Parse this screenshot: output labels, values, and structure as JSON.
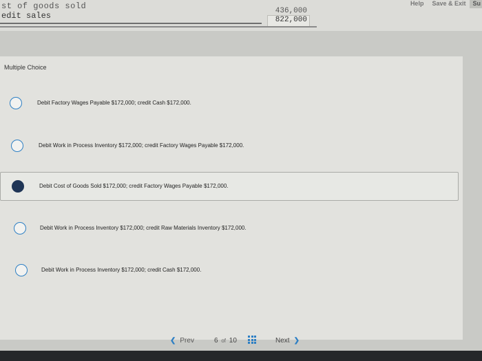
{
  "header": {
    "help_label": "Help",
    "save_exit_label": "Save & Exit",
    "submit_label": "Su"
  },
  "problem_table": {
    "row1_text": "st of goods sold",
    "row2_text": "edit sales",
    "row1_amount": "436,000",
    "row2_amount": "822,000"
  },
  "question": {
    "type_label": "Multiple Choice",
    "selected_index": 2,
    "options": [
      {
        "text": "Debit Factory Wages Payable $172,000; credit Cash $172,000."
      },
      {
        "text": "Debit Work in Process Inventory $172,000; credit Factory Wages Payable $172,000."
      },
      {
        "text": "Debit Cost of Goods Sold $172,000; credit Factory Wages Payable $172,000."
      },
      {
        "text": "Debit Work in Process Inventory $172,000; credit Raw Materials Inventory $172,000."
      },
      {
        "text": "Debit Work in Process Inventory $172,000; credit Cash $172,000."
      }
    ]
  },
  "navigation": {
    "prev_label": "Prev",
    "current_page": "6",
    "of_label": "of",
    "total_pages": "10",
    "next_label": "Next",
    "prev_icon": "chevron-left-icon",
    "next_icon": "chevron-right-icon",
    "grid_icon": "grid-icon"
  },
  "colors": {
    "accent": "#2d7fc4",
    "selected_radio": "#1f3556"
  }
}
